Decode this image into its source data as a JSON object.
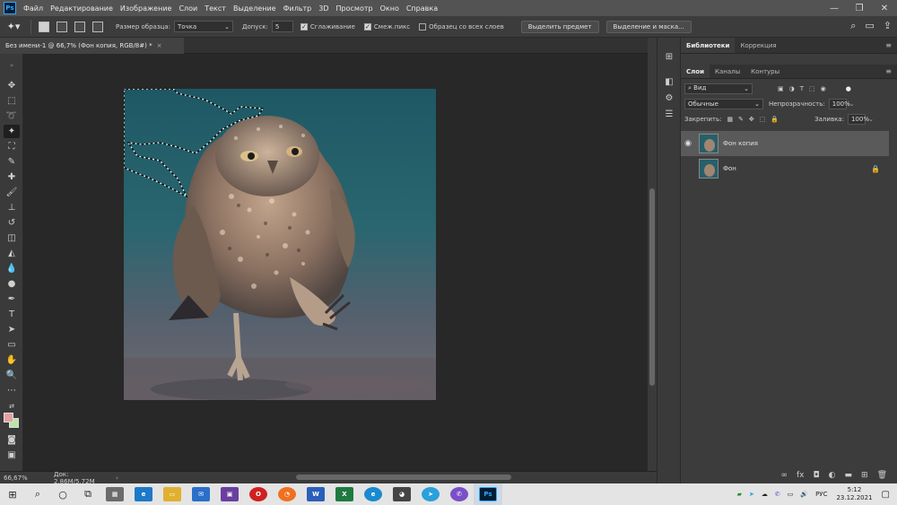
{
  "menubar": {
    "logo": "Ps",
    "items": [
      "Файл",
      "Редактирование",
      "Изображение",
      "Слои",
      "Текст",
      "Выделение",
      "Фильтр",
      "3D",
      "Просмотр",
      "Окно",
      "Справка"
    ],
    "controls": [
      "—",
      "❐",
      "✕"
    ]
  },
  "options": {
    "sample_size_label": "Размер образца:",
    "sample_size_value": "Точка",
    "tolerance_label": "Допуск:",
    "tolerance_value": "5",
    "antialias_label": "Сглаживание",
    "antialias_checked": true,
    "contiguous_label": "Смеж.пикс",
    "contiguous_checked": true,
    "sample_all_label": "Образец со всех слоев",
    "sample_all_checked": false,
    "select_subject_label": "Выделить предмет",
    "select_mask_label": "Выделение и маска..."
  },
  "document": {
    "tab_title": "Без имени-1 @ 66,7% (Фон копия, RGB/8#) *",
    "close": "×"
  },
  "status": {
    "zoom": "66,67%",
    "doc_size": "Док: 2,86M/5,72M"
  },
  "panels": {
    "top_tabs": [
      "Библиотеки",
      "Коррекция"
    ],
    "layer_tabs": [
      "Слои",
      "Каналы",
      "Контуры"
    ],
    "filter_label": "Вид",
    "blend_mode": "Обычные",
    "opacity_label": "Непрозрачность:",
    "opacity_value": "100%",
    "lock_label": "Закрепить:",
    "fill_label": "Заливка:",
    "fill_value": "100%",
    "layers": [
      {
        "name": "Фон копия",
        "selected": true,
        "visible": true,
        "locked": false
      },
      {
        "name": "Фон",
        "selected": false,
        "visible": false,
        "locked": true
      }
    ]
  },
  "taskbar": {
    "language": "РУС",
    "time": "5:12",
    "date": "23.12.2021"
  },
  "colors": {
    "foreground": "#e5a1a0",
    "background": "#b8e6a6",
    "accent": "#31a8ff"
  }
}
